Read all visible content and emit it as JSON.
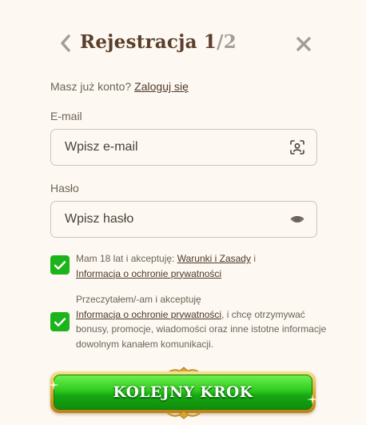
{
  "header": {
    "title": "Rejestracja 1",
    "step": "/2",
    "back_icon": "chevron-left-icon",
    "close_icon": "close-icon"
  },
  "login_prompt": {
    "text": "Masz już konto?",
    "link": "Zaloguj się"
  },
  "email": {
    "label": "E-mail",
    "placeholder": "Wpisz e-mail",
    "value": "",
    "icon": "scan-face-icon"
  },
  "password": {
    "label": "Hasło",
    "placeholder": "Wpisz hasło",
    "value": "",
    "icon": "eye-icon"
  },
  "consents": [
    {
      "checked": true,
      "text_before": "Mam 18 lat i akceptuję: ",
      "link1": "Warunki i Zasady",
      "text_mid": " i",
      "link2": "Informacja o ochronie prywatności",
      "text_after": ""
    },
    {
      "checked": true,
      "text_before": "Przeczytałem/-am i akceptuję",
      "link1": "Informacja o ochronie prywatności",
      "text_after": ", i chcę otrzymywać bonusy, promocje, wiadomości oraz inne istotne informacje dowolnym kanałem komunikacji."
    }
  ],
  "cta": {
    "label": "KOLEJNY KROK"
  },
  "colors": {
    "background": "#fdf8f1",
    "title": "#5a3e2b",
    "checkbox": "#1bb41b",
    "cta_green": "#2ecb1e",
    "cta_gold": "#d9a630"
  }
}
